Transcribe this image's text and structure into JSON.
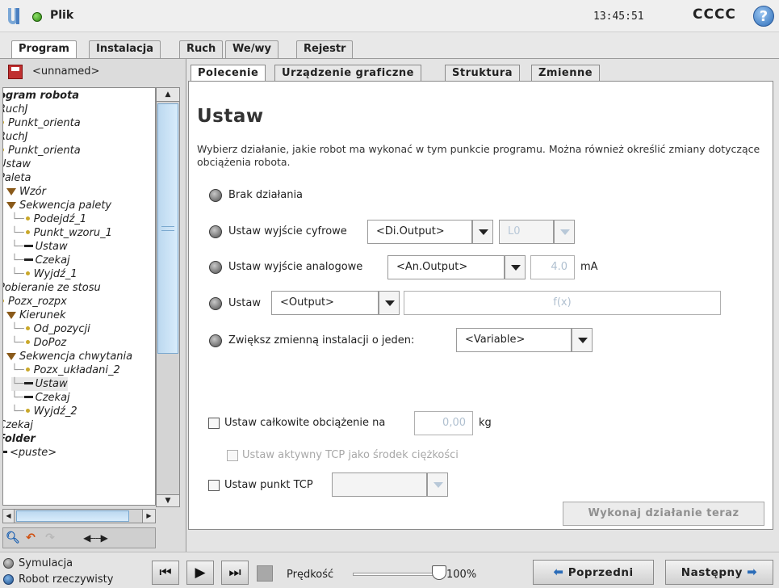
{
  "header": {
    "file_label": "Plik",
    "clock": "13:45:51",
    "robot_name": "CCCC",
    "help": "?"
  },
  "main_tabs": [
    "Program",
    "Instalacja",
    "Ruch",
    "We/wy",
    "Rejestr"
  ],
  "program": {
    "name": "<unnamed>"
  },
  "tree": [
    {
      "text": "ogram robota",
      "bold": true,
      "icon": "none",
      "indent": 0
    },
    {
      "text": "RuchJ",
      "bold": false,
      "icon": "none",
      "indent": 0
    },
    {
      "text": "Punkt_orienta",
      "bold": false,
      "icon": "dot",
      "indent": 0
    },
    {
      "text": "RuchJ",
      "bold": false,
      "icon": "none",
      "indent": 0
    },
    {
      "text": "Punkt_orienta",
      "bold": false,
      "icon": "dot",
      "indent": 0
    },
    {
      "text": "Ustaw",
      "bold": false,
      "icon": "none",
      "indent": 0
    },
    {
      "text": "Paleta",
      "bold": false,
      "icon": "none",
      "indent": 0
    },
    {
      "text": "Wzór",
      "bold": false,
      "icon": "tri",
      "indent": 1
    },
    {
      "text": "Sekwencja palety",
      "bold": false,
      "icon": "tri",
      "indent": 1
    },
    {
      "text": "Podejdź_1",
      "bold": false,
      "icon": "dot",
      "indent": 2
    },
    {
      "text": "Punkt_wzoru_1",
      "bold": false,
      "icon": "dot",
      "indent": 2
    },
    {
      "text": "Ustaw",
      "bold": false,
      "icon": "dash",
      "indent": 2
    },
    {
      "text": "Czekaj",
      "bold": false,
      "icon": "dash",
      "indent": 2
    },
    {
      "text": "Wyjdź_1",
      "bold": false,
      "icon": "dot",
      "indent": 2
    },
    {
      "text": "Pobieranie ze stosu",
      "bold": false,
      "icon": "none",
      "indent": 0
    },
    {
      "text": "Pozx_rozpx",
      "bold": false,
      "icon": "dot",
      "indent": 0
    },
    {
      "text": "Kierunek",
      "bold": false,
      "icon": "tri",
      "indent": 1
    },
    {
      "text": "Od_pozycji",
      "bold": false,
      "icon": "dot",
      "indent": 2
    },
    {
      "text": "DoPoz",
      "bold": false,
      "icon": "dot",
      "indent": 2
    },
    {
      "text": "Sekwencja chwytania",
      "bold": false,
      "icon": "tri",
      "indent": 1
    },
    {
      "text": "Pozx_układani_2",
      "bold": false,
      "icon": "dot",
      "indent": 2
    },
    {
      "text": "Ustaw",
      "bold": false,
      "icon": "dash",
      "indent": 2,
      "selected": true
    },
    {
      "text": "Czekaj",
      "bold": false,
      "icon": "dash",
      "indent": 2
    },
    {
      "text": "Wyjdź_2",
      "bold": false,
      "icon": "dot",
      "indent": 2
    },
    {
      "text": "Czekaj",
      "bold": false,
      "icon": "none",
      "indent": 0
    },
    {
      "text": "Folder",
      "bold": true,
      "icon": "none",
      "indent": 0
    },
    {
      "text": "<puste>",
      "bold": false,
      "icon": "dash",
      "indent": 0
    }
  ],
  "sub_tabs": [
    "Polecenie",
    "Urządzenie graficzne",
    "Struktura",
    "Zmienne"
  ],
  "command": {
    "title": "Ustaw",
    "description": "Wybierz działanie, jakie robot ma wykonać w tym punkcie programu. Można również określić zmiany dotyczące obciążenia robota.",
    "option_none": "Brak działania",
    "option_digital": "Ustaw wyjście cyfrowe",
    "digital_output": "<Di.Output>",
    "digital_value": "L0",
    "option_analog": "Ustaw wyjście analogowe",
    "analog_output": "<An.Output>",
    "analog_value": "4.0",
    "analog_unit": "mA",
    "option_set": "Ustaw",
    "set_output": "<Output>",
    "set_expression": "f(x)",
    "option_increment": "Zwiększ zmienną instalacji o jeden:",
    "increment_variable": "<Variable>",
    "payload_label": "Ustaw całkowite obciążenie na",
    "payload_value": "0,00",
    "payload_unit": "kg",
    "tcp_cog_label": "Ustaw aktywny TCP jako środek ciężkości",
    "tcp_label": "Ustaw punkt TCP",
    "exec_button": "Wykonaj działanie teraz"
  },
  "footer": {
    "mode_sim": "Symulacja",
    "mode_real": "Robot rzeczywisty",
    "speed_label": "Prędkość",
    "speed_value": "100%",
    "speed_fraction": 1.0,
    "prev": "Poprzedni",
    "next": "Następny"
  }
}
